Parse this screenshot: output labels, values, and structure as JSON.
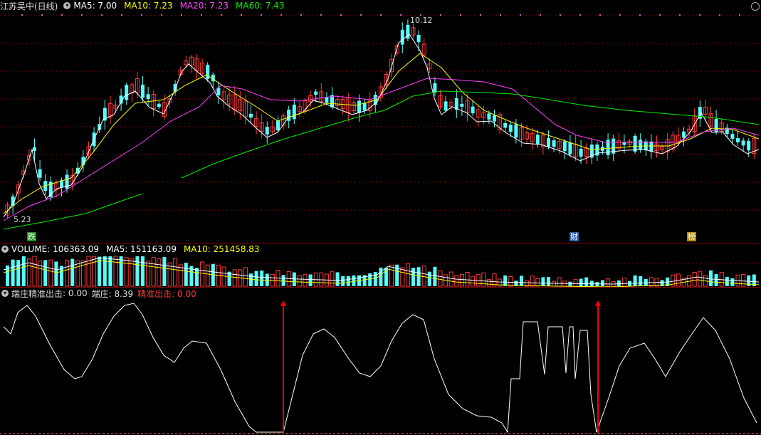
{
  "price_panel": {
    "title": "江苏吴中(日线)",
    "ma5": "MA5: 7.00",
    "ma10": "MA10: 7.23",
    "ma20": "MA20: 7.23",
    "ma60": "MA60: 7.43",
    "high_label": "10.12",
    "low_label": "5.23",
    "tags": [
      "跌",
      "财",
      "榜"
    ]
  },
  "volume_panel": {
    "volume": "VOLUME: 106363.09",
    "ma5": "MA5: 151163.09",
    "ma10": "MA10: 251458.83"
  },
  "indicator_panel": {
    "name": "端庄精准出击",
    "v1": ": 0.00",
    "v2": "端庄: 8.39",
    "v3": "精准出击: 0.00"
  },
  "colors": {
    "up": "#ff3b3b",
    "down": "#54ffff",
    "ma5": "#ffffff",
    "ma10": "#ffff00",
    "ma20": "#ff40ff",
    "ma60": "#00ee00",
    "grid": "#8b0000",
    "signal": "#ff0000"
  }
}
